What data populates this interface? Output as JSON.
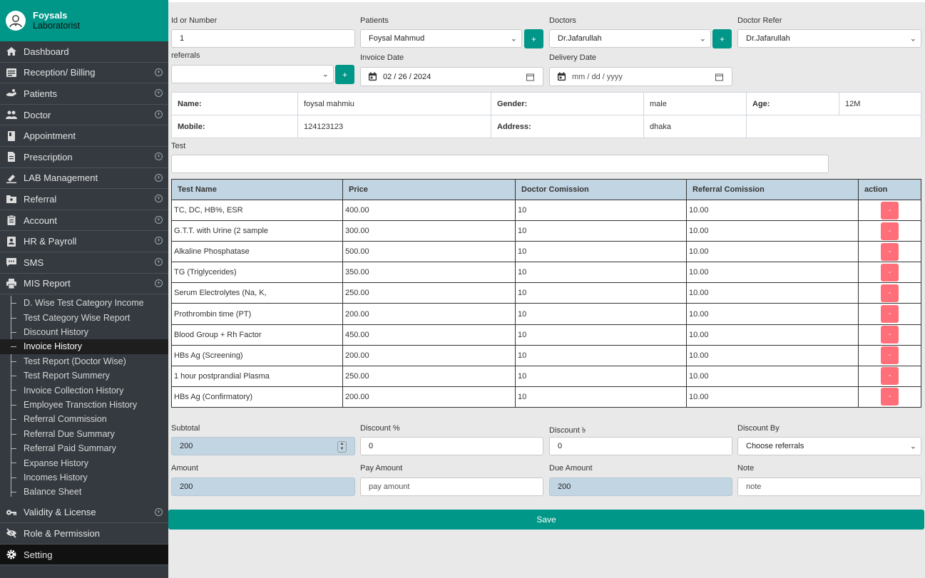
{
  "profile": {
    "name": "Foysals",
    "role": "Laboratorist"
  },
  "nav": [
    {
      "label": "Dashboard",
      "icon": "home-icon",
      "expand": false
    },
    {
      "label": "Reception/ Billing",
      "icon": "billing-icon",
      "expand": true
    },
    {
      "label": "Patients",
      "icon": "patients-icon",
      "expand": true
    },
    {
      "label": "Doctor",
      "icon": "doctor-icon",
      "expand": true
    },
    {
      "label": "Appointment",
      "icon": "book-icon",
      "expand": false
    },
    {
      "label": "Prescription",
      "icon": "document-icon",
      "expand": true
    },
    {
      "label": "LAB Management",
      "icon": "flask-icon",
      "expand": true
    },
    {
      "label": "Referral",
      "icon": "folder-icon",
      "expand": true
    },
    {
      "label": "Account",
      "icon": "clipboard-icon",
      "expand": true
    },
    {
      "label": "HR & Payroll",
      "icon": "badge-icon",
      "expand": true
    },
    {
      "label": "SMS",
      "icon": "chat-icon",
      "expand": true
    },
    {
      "label": "MIS Report",
      "icon": "printer-icon",
      "expand": true
    }
  ],
  "mis_submenu": [
    "D. Wise Test Category Income",
    "Test Category Wise Report",
    "Discount History",
    "Invoice History",
    "Test Report (Doctor Wise)",
    "Test Report Summery",
    "Invoice Collection History",
    "Employee Transction History",
    "Referral Commission",
    "Referral Due Summary",
    "Referral Paid Summary",
    "Expanse History",
    "Incomes History",
    "Balance Sheet"
  ],
  "nav_bottom": [
    {
      "label": "Validity & License",
      "icon": "key-icon",
      "expand": true
    },
    {
      "label": "Role & Permission",
      "icon": "eye-slash-icon",
      "expand": false
    },
    {
      "label": "Setting",
      "icon": "gear-icon",
      "expand": false
    }
  ],
  "form": {
    "id_label": "Id or Number",
    "id_value": "1",
    "patients_label": "Patients",
    "patients_value": "Foysal Mahmud",
    "doctors_label": "Doctors",
    "doctors_value": "Dr.Jafarullah",
    "doctor_refer_label": "Doctor Refer",
    "doctor_refer_value": "Dr.Jafarullah",
    "referrals_label": "referrals",
    "referrals_value": "",
    "invoice_date_label": "Invoice Date",
    "invoice_date_value": "02 / 26 / 2024",
    "delivery_date_label": "Delivery Date",
    "delivery_date_placeholder": "mm / dd / yyyy",
    "add_label": "+"
  },
  "patient_info": {
    "name_label": "Name:",
    "name_value": "foysal mahmiu",
    "gender_label": "Gender:",
    "gender_value": "male",
    "age_label": "Age:",
    "age_value": "12M",
    "mobile_label": "Mobile:",
    "mobile_value": "124123123",
    "address_label": "Address:",
    "address_value": "dhaka"
  },
  "test": {
    "label": "Test",
    "value": ""
  },
  "tests_table": {
    "headers": [
      "Test Name",
      "Price",
      "Doctor Comission",
      "Referral Comission",
      "action"
    ],
    "delete_label": "-",
    "rows": [
      [
        " TC, DC, HB%, ESR",
        "400.00",
        "10",
        "10.00"
      ],
      [
        "G.T.T. with Urine (2 sample",
        "300.00",
        "10",
        "10.00"
      ],
      [
        "Alkaline Phosphatase",
        "500.00",
        "10",
        "10.00"
      ],
      [
        " TG (Triglycerides)",
        "350.00",
        "10",
        "10.00"
      ],
      [
        "Serum Electrolytes (Na, K,",
        "250.00",
        "10",
        "10.00"
      ],
      [
        "Prothrombin time (PT)",
        "200.00",
        "10",
        "10.00"
      ],
      [
        "Blood Group + Rh Factor",
        "450.00",
        "10",
        "10.00"
      ],
      [
        "HBs Ag (Screening)",
        "200.00",
        "10",
        "10.00"
      ],
      [
        "1 hour postprandial Plasma",
        "250.00",
        "10",
        "10.00"
      ],
      [
        "HBs Ag (Confirmatory)",
        "200.00",
        "10",
        "10.00"
      ]
    ]
  },
  "totals": {
    "subtotal_label": "Subtotal",
    "subtotal_value": "200",
    "discount_pct_label": "Discount %",
    "discount_pct_value": "0",
    "discount_tk_label": "Discount ৳",
    "discount_tk_value": "0",
    "discount_by_label": "Discount By",
    "discount_by_value": "Choose referrals",
    "amount_label": "Amount",
    "amount_value": "200",
    "pay_amount_label": "Pay Amount",
    "pay_amount_placeholder": "pay amount",
    "due_amount_label": "Due Amount",
    "due_amount_value": "200",
    "note_label": "Note",
    "note_placeholder": "note"
  },
  "save_label": "Save",
  "active_submenu": "Invoice History",
  "colors": {
    "teal": "#009688",
    "sidebar": "#343a40",
    "readonly": "#c2d5e3",
    "delete": "#ff6f79"
  }
}
